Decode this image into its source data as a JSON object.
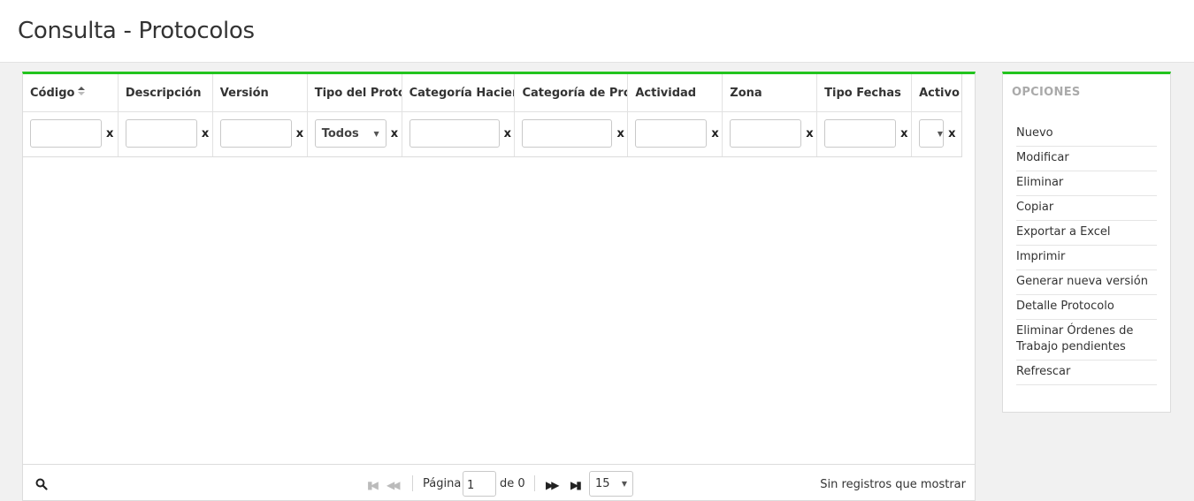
{
  "page": {
    "title": "Consulta - Protocolos"
  },
  "grid": {
    "columns": [
      {
        "label": "Código",
        "sorted": true
      },
      {
        "label": "Descripción"
      },
      {
        "label": "Versión"
      },
      {
        "label": "Tipo del Protoc"
      },
      {
        "label": "Categoría Haciend"
      },
      {
        "label": "Categoría de Proto"
      },
      {
        "label": "Actividad"
      },
      {
        "label": "Zona"
      },
      {
        "label": "Tipo Fechas"
      },
      {
        "label": "Activo"
      }
    ],
    "filters": {
      "tipo_protocolo_value": "Todos",
      "activo_value": "",
      "clear_label": "x"
    },
    "rows": []
  },
  "pager": {
    "page_label": "Página",
    "current_page": "1",
    "of_label": "de 0",
    "page_size": "15",
    "status_text": "Sin registros que mostrar"
  },
  "options": {
    "title": "OPCIONES",
    "items": [
      "Nuevo",
      "Modificar",
      "Eliminar",
      "Copiar",
      "Exportar a Excel",
      "Imprimir",
      "Generar nueva versión",
      "Detalle Protocolo",
      "Eliminar Órdenes de Trabajo pendientes",
      "Refrescar"
    ]
  },
  "colors": {
    "accent": "#22c41e",
    "background": "#f1f1f1",
    "panel": "#ffffff"
  },
  "icons": {
    "search": "search-icon",
    "sort": "sort-icon",
    "first": "first-page-icon",
    "prev": "prev-page-icon",
    "next": "next-page-icon",
    "last": "last-page-icon"
  }
}
